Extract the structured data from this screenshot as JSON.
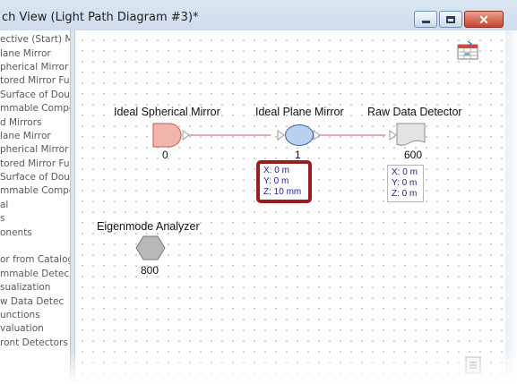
{
  "window": {
    "title": "ch View (Light Path Diagram #3)*",
    "buttons": {
      "minimize": "minimize",
      "maximize": "maximize",
      "close": "close"
    }
  },
  "tree": {
    "items": [
      "ective (Start) Mi",
      "lane Mirror",
      "pherical Mirror",
      "tored Mirror Fu",
      "Surface of Dou",
      "mmable Compo",
      "d Mirrors",
      "lane Mirror",
      "pherical Mirror",
      "tored Mirror Fu",
      "Surface of Dou",
      "mmable Compo",
      "al",
      "s",
      "onents",
      "",
      "or from Catalog",
      "mmable Detec",
      "sualization",
      "w Data Detec",
      "unctions",
      "valuation",
      "ront Detectors"
    ]
  },
  "diagram": {
    "components": [
      {
        "label": "Ideal Spherical Mirror",
        "number": "0"
      },
      {
        "label": "Ideal Plane Mirror",
        "number": "1"
      },
      {
        "label": "Raw Data Detector",
        "number": "600"
      },
      {
        "label": "Eigenmode Analyzer",
        "number": "800"
      }
    ],
    "positions": {
      "plane_mirror": {
        "x": "X: 0 m",
        "y": "Y: 0 m",
        "z": "Z: 10 mm"
      },
      "detector": {
        "x": "X: 0 m",
        "y": "Y: 0 m",
        "z": "Z: 0 m"
      }
    }
  },
  "icons": {
    "table": "table-settings-icon",
    "notes": "document-icon"
  },
  "colors": {
    "connector": "#d9776f",
    "highlight": "#9b1c22",
    "position_text": "#23238c",
    "spherical_mirror": "#f2b5ab",
    "plane_mirror": "#b9d0f2",
    "analyzer": "#b8b8b8"
  }
}
